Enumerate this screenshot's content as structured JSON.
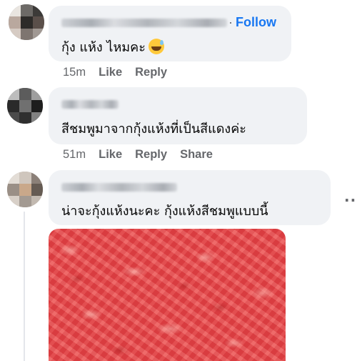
{
  "comments": [
    {
      "text": "กุ้ง แห้ง ไหมคะ",
      "emoji": "sweat-smile-emoji",
      "follow_label": "Follow",
      "time": "15m",
      "actions": [
        "Like",
        "Reply"
      ]
    },
    {
      "text": "สีชมพูมาจากกุ้งแห้งที่เป็นสีแดงค่ะ",
      "time": "51m",
      "actions": [
        "Like",
        "Reply",
        "Share"
      ]
    },
    {
      "text": "น่าจะกุ้งแห้งนะคะ กุ้งแห้งสีชมพูแบบนี้",
      "more_label": "···",
      "attachment": "photo-dried-shrimp"
    }
  ],
  "colors": {
    "bubble": "#f0f2f5",
    "link": "#1877f2",
    "meta": "#65676b",
    "photo": "#e84a4e"
  }
}
